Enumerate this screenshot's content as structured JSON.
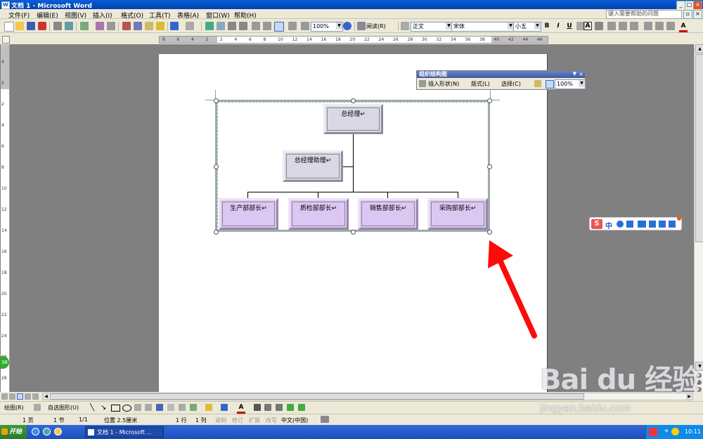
{
  "window": {
    "title": "文档 1 - Microsoft Word",
    "app_icon": "W"
  },
  "menu": {
    "items": [
      "文件(F)",
      "编辑(E)",
      "视图(V)",
      "插入(I)",
      "格式(O)",
      "工具(T)",
      "表格(A)",
      "窗口(W)",
      "帮助(H)"
    ],
    "help_placeholder": "键入需要帮助的问题"
  },
  "toolbar": {
    "zoom": "100%",
    "read_label": "阅读(R)",
    "style": "正文",
    "font": "宋体",
    "size": "小五",
    "bold": "B",
    "italic": "I",
    "underline": "U",
    "border_a": "A",
    "font_color_a": "A"
  },
  "ruler": {
    "numbers": [
      "8",
      "6",
      "4",
      "2",
      "2",
      "4",
      "6",
      "8",
      "10",
      "12",
      "14",
      "16",
      "18",
      "20",
      "22",
      "24",
      "26",
      "28",
      "30",
      "32",
      "34",
      "36",
      "38",
      "40",
      "42",
      "44",
      "46",
      "48"
    ],
    "v_numbers": [
      "4",
      "2",
      "2",
      "4",
      "6",
      "8",
      "10",
      "12",
      "14",
      "16",
      "18",
      "20",
      "22",
      "24",
      "26",
      "28"
    ]
  },
  "org_chart": {
    "nodes": {
      "gm": "总经理↵",
      "assistant": "总经理助理↵",
      "production": "生产部部长↵",
      "qc": "质检部部长↵",
      "sales": "销售部部长↵",
      "purchase": "采购部部长↵"
    },
    "toolbar": {
      "title": "组织结构图",
      "insert_shape": "插入形状(N)",
      "layout": "版式(L)",
      "select": "选择(C)",
      "zoom": "100%"
    }
  },
  "drawing_bar": {
    "draw": "绘图(R)",
    "autoshapes": "自选图形(U)"
  },
  "status": {
    "page": "1 页",
    "section": "1 节",
    "page_of": "1/1",
    "position": "位置 2.5厘米",
    "line": "1 行",
    "column": "1 列",
    "rec": "录制",
    "trk": "修订",
    "ext": "扩展",
    "ovr": "改写",
    "language": "中文(中国)"
  },
  "taskbar": {
    "start": "开始",
    "task": "文档 1 - Microsoft ...",
    "clock": "10:11",
    "tray_chevron": "«"
  },
  "ime": {
    "label": "中"
  },
  "badge": "36",
  "watermark": {
    "brand": "Bai du 经验",
    "url": "jingyan.baidu.com"
  },
  "colors": {
    "title_bar": "#0a5fd8",
    "arrow": "#ff0a0a",
    "org_grey": "#d9d8e5",
    "org_purple": "#dcc7f2"
  }
}
